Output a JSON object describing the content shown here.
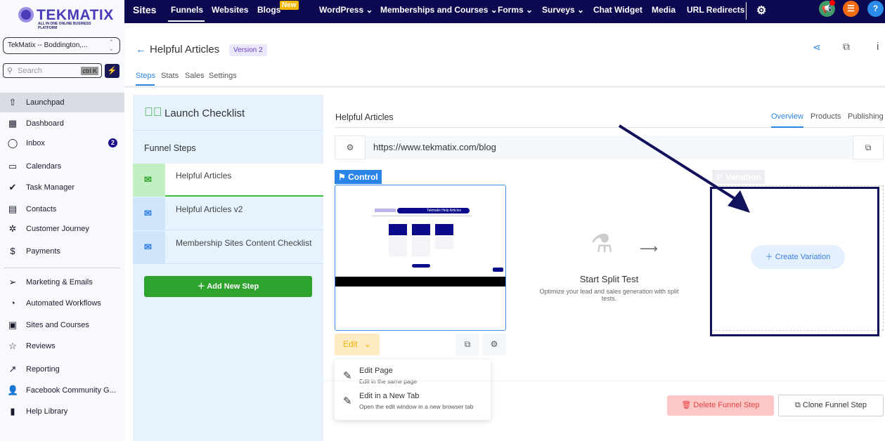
{
  "brand": {
    "name": "TEKMATIX",
    "tagline": "ALL IN ONE ONLINE BUSINESS PLATFORM"
  },
  "account": {
    "name": "TekMatix -- Boddington,..."
  },
  "search": {
    "placeholder": "Search",
    "shortcut": "ctrl K"
  },
  "sidebar": {
    "items": [
      {
        "label": "Launchpad",
        "icon": "launchpad-icon",
        "glyph": "⇧",
        "active": true
      },
      {
        "label": "Dashboard",
        "icon": "dashboard-icon",
        "glyph": "▦"
      },
      {
        "label": "Inbox",
        "icon": "chat-icon",
        "glyph": "◯",
        "badge": "2"
      },
      {
        "label": "Calendars",
        "icon": "calendar-icon",
        "glyph": "▭"
      },
      {
        "label": "Task Manager",
        "icon": "check-circle-icon",
        "glyph": "✔"
      },
      {
        "label": "Contacts",
        "icon": "contacts-icon",
        "glyph": "▤"
      },
      {
        "label": "Customer Journey",
        "icon": "journey-icon",
        "glyph": "✲"
      },
      {
        "label": "Payments",
        "icon": "payments-icon",
        "glyph": "$"
      },
      {
        "label": "Marketing & Emails",
        "icon": "send-icon",
        "glyph": "➢"
      },
      {
        "label": "Automated Workflows",
        "icon": "workflow-icon",
        "glyph": "◔"
      },
      {
        "label": "Sites and Courses",
        "icon": "sites-icon",
        "glyph": "▣"
      },
      {
        "label": "Reviews",
        "icon": "star-icon",
        "glyph": "☆"
      },
      {
        "label": "Reporting",
        "icon": "trend-icon",
        "glyph": "↗"
      },
      {
        "label": "Facebook Community G...",
        "icon": "user-plus-icon",
        "glyph": "👤"
      },
      {
        "label": "Help Library",
        "icon": "book-icon",
        "glyph": "▮"
      }
    ]
  },
  "topnav": {
    "section": "Sites",
    "items": [
      "Funnels",
      "Websites",
      "Blogs",
      "WordPress",
      "Memberships and Courses",
      "Forms",
      "Surveys",
      "Chat Widget",
      "Media",
      "URL Redirects"
    ],
    "new_badge": "New",
    "active": "Funnels"
  },
  "header": {
    "title": "Helpful Articles",
    "version": "Version 2",
    "tabs": [
      "Steps",
      "Stats",
      "Sales",
      "Settings"
    ],
    "active_tab": "Steps"
  },
  "checklist": {
    "title": "Launch Checklist",
    "steps_heading": "Funnel Steps",
    "steps": [
      "Helpful Articles",
      "Helpful Articles v2",
      "Membership Sites Content Checklist"
    ],
    "add_label": "Add New Step"
  },
  "main": {
    "title": "Helpful Articles",
    "tabs": [
      "Overview",
      "Products",
      "Publishing"
    ],
    "active_tab": "Overview",
    "url": "https://www.tekmatix.com/blog",
    "control_label": "Control",
    "variation_label": "Variation",
    "edit_label": "Edit",
    "menu": [
      {
        "title": "Edit Page",
        "sub": "Edit in the same page"
      },
      {
        "title": "Edit in a New Tab",
        "sub": "Open the edit window in a new browser tab"
      }
    ],
    "split_title": "Start Split Test",
    "split_sub": "Optimize your lead and sales generation with split tests.",
    "create_variation": "Create Variation",
    "delete_label": "Delete Funnel Step",
    "clone_label": "Clone Funnel Step",
    "preview_title": "Tekmatix Help Articles"
  },
  "colors": {
    "nav_bg": "#0c0950",
    "accent": "#2b85e8",
    "green": "#2ea32e",
    "annotation": "#12125c"
  }
}
